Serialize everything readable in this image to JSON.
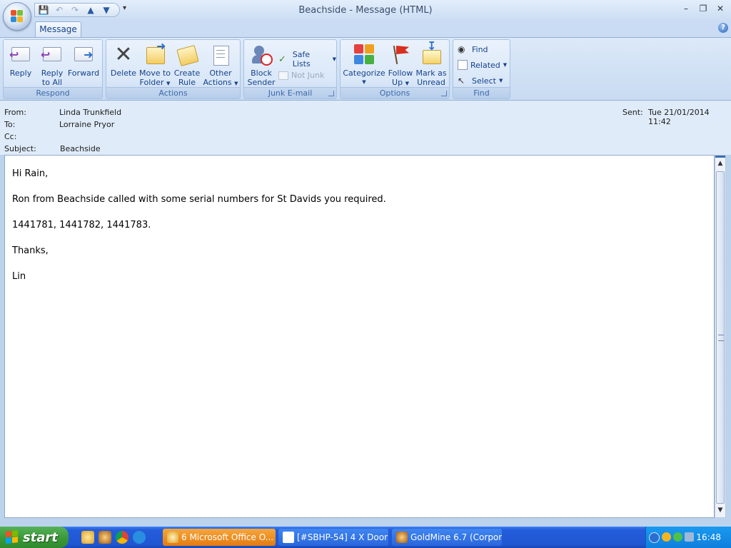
{
  "window": {
    "title": "Beachside  - Message (HTML)",
    "controls": {
      "minimize": "–",
      "restore": "❐",
      "close": "✕"
    }
  },
  "qat": {
    "items": [
      "save-icon",
      "undo-icon",
      "redo-icon",
      "previous-item-icon",
      "next-item-icon"
    ],
    "more": "▾"
  },
  "tabs": [
    {
      "label": "Message",
      "selected": true
    }
  ],
  "help": "?",
  "ribbon": {
    "respond": {
      "label": "Respond",
      "reply": "Reply",
      "reply_all_1": "Reply",
      "reply_all_2": "to All",
      "forward": "Forward"
    },
    "actions": {
      "label": "Actions",
      "delete": "Delete",
      "move_1": "Move to",
      "move_2": "Folder",
      "create_1": "Create",
      "create_2": "Rule",
      "other_1": "Other",
      "other_2": "Actions"
    },
    "junk": {
      "label": "Junk E-mail",
      "block_1": "Block",
      "block_2": "Sender",
      "safe_lists": "Safe Lists",
      "not_junk": "Not Junk"
    },
    "options": {
      "label": "Options",
      "categorize": "Categorize",
      "follow_1": "Follow",
      "follow_2": "Up",
      "mark_1": "Mark as",
      "mark_2": "Unread"
    },
    "find": {
      "label": "Find",
      "find": "Find",
      "related": "Related",
      "select": "Select"
    }
  },
  "header": {
    "from_label": "From:",
    "from": "Linda Trunkfield",
    "to_label": "To:",
    "to": "Lorraine Pryor",
    "cc_label": "Cc:",
    "cc": "",
    "subject_label": "Subject:",
    "subject": "Beachside",
    "sent_label": "Sent:",
    "sent": "Tue 21/01/2014 11:42"
  },
  "message_body": [
    "Hi Rain,",
    "Ron from Beachside called with some serial numbers for St Davids you required.",
    "1441781, 1441782, 1441783.",
    "Thanks,",
    "Lin"
  ],
  "taskbar": {
    "start": "start",
    "quick_launch": [
      "outlook-icon",
      "goldmine-icon",
      "chrome-icon",
      "skype-icon"
    ],
    "buttons": [
      {
        "label": "6 Microsoft Office O...",
        "active": true
      },
      {
        "label": "[#SBHP-54] 4 X Door ...",
        "active": false
      },
      {
        "label": "GoldMine 6.7 (Corpor...",
        "active": false
      }
    ],
    "clock": "16:48"
  },
  "colors": {
    "ribbon_text": "#15428b",
    "taskbar_blue": "#245ddb",
    "start_green": "#3c9a3a",
    "active_task_orange": "#f08a1c"
  }
}
